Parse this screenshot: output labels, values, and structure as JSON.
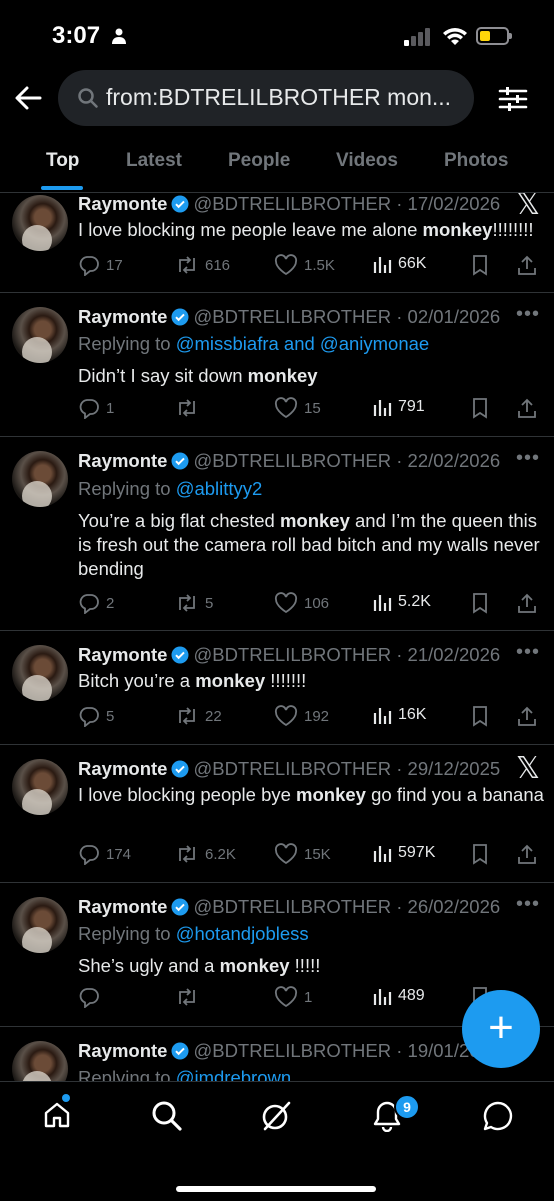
{
  "status_bar": {
    "time": "3:07"
  },
  "search": {
    "query": "from:BDTRELILBROTHER mon..."
  },
  "tabs": [
    {
      "label": "Top",
      "active": true
    },
    {
      "label": "Latest"
    },
    {
      "label": "People"
    },
    {
      "label": "Videos"
    },
    {
      "label": "Photos"
    }
  ],
  "tweets": [
    {
      "name": "Raymonte",
      "handle": "@BDTRELILBROTHER",
      "date": "· 17/02/2026",
      "replying_label": "",
      "replying_users": "",
      "text_pre": "I love blocking me people leave me alone ",
      "text_bold": "monkey",
      "text_post": "!!!!!!!!",
      "replies": "17",
      "reposts": "616",
      "likes": "1.5K",
      "views": "66K"
    },
    {
      "name": "Raymonte",
      "handle": "@BDTRELILBROTHER",
      "date": "· 02/01/2026",
      "replying_label": "Replying to",
      "replying_users": "@missbiafra and @aniymonae",
      "text_pre": "Didn’t I say sit down ",
      "text_bold": "monkey",
      "text_post": "",
      "replies": "1",
      "reposts": "",
      "likes": "15",
      "views": "791"
    },
    {
      "name": "Raymonte",
      "handle": "@BDTRELILBROTHER",
      "date": "· 22/02/2026",
      "replying_label": "Replying to",
      "replying_users": "@ablittyy2",
      "text_pre": "You’re a big flat chested ",
      "text_bold": "monkey",
      "text_post": " and I’m the queen this is fresh out the camera roll bad bitch and my walls never bending",
      "replies": "2",
      "reposts": "5",
      "likes": "106",
      "views": "5.2K"
    },
    {
      "name": "Raymonte",
      "handle": "@BDTRELILBROTHER",
      "date": "· 21/02/2026",
      "replying_label": "",
      "replying_users": "",
      "text_pre": "Bitch you’re a ",
      "text_bold": "monkey",
      "text_post": " !!!!!!!",
      "replies": "5",
      "reposts": "22",
      "likes": "192",
      "views": "16K"
    },
    {
      "name": "Raymonte",
      "handle": "@BDTRELILBROTHER",
      "date": "· 29/12/2025",
      "replying_label": "",
      "replying_users": "",
      "text_pre": "I love blocking people bye ",
      "text_bold": "monkey",
      "text_post": " go find you a banana",
      "replies": "174",
      "reposts": "6.2K",
      "likes": "15K",
      "views": "597K"
    },
    {
      "name": "Raymonte",
      "handle": "@BDTRELILBROTHER",
      "date": "· 26/02/2026",
      "replying_label": "Replying to",
      "replying_users": "@hotandjobless",
      "text_pre": "She’s ugly and a ",
      "text_bold": "monkey",
      "text_post": " !!!!!",
      "replies": "",
      "reposts": "",
      "likes": "1",
      "views": "489"
    },
    {
      "name": "Raymonte",
      "handle": "@BDTRELILBROTHER",
      "date": "· 19/01/20",
      "replying_label": "Replying to",
      "replying_users": "@imdrebrown",
      "text_pre": "",
      "text_bold": "",
      "text_post": "",
      "replies": "",
      "reposts": "",
      "likes": "",
      "views": ""
    }
  ],
  "notifications_badge": "9",
  "colors": {
    "accent": "#1d9bf0",
    "background": "#000000",
    "muted": "#71767b"
  }
}
